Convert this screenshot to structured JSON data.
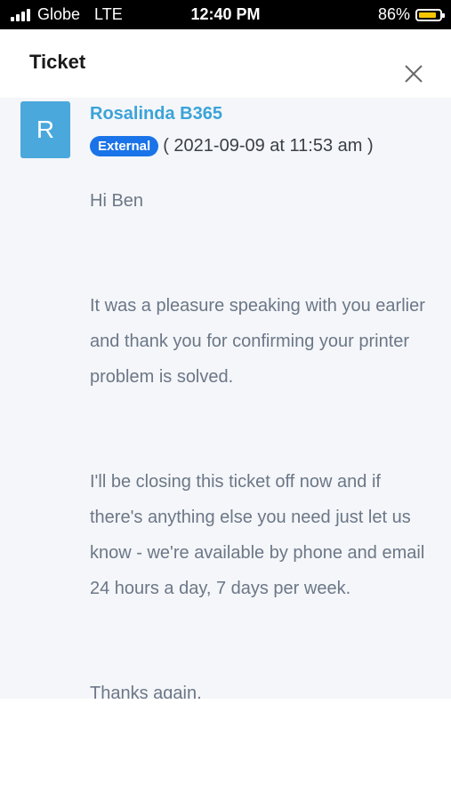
{
  "status_bar": {
    "carrier": "Globe",
    "network": "LTE",
    "time": "12:40 PM",
    "battery": "86%",
    "battery_level": 0.86,
    "battery_color": "#f7c600"
  },
  "header": {
    "title": "Ticket",
    "close_icon": "close-icon"
  },
  "message": {
    "avatar_letter": "R",
    "avatar_color": "#4aa8dc",
    "author": "Rosalinda B365",
    "badge": "External",
    "badge_color": "#1a73e8",
    "timestamp": "( 2021-09-09 at 11:53 am )",
    "greeting": "Hi Ben",
    "paragraph_1": "It was a pleasure speaking with you earlier and thank you for confirming your printer problem is solved.",
    "paragraph_2": "I'll be closing this ticket off now and if there's anything else you need just let us know - we're available by phone and email 24 hours a day, 7 days per week.",
    "closing": "Thanks again,"
  }
}
